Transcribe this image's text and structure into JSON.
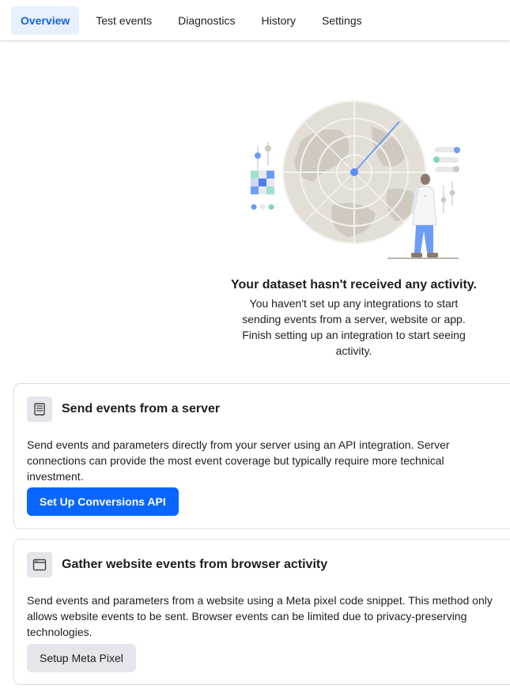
{
  "tabs": [
    {
      "label": "Overview",
      "active": true
    },
    {
      "label": "Test events",
      "active": false
    },
    {
      "label": "Diagnostics",
      "active": false
    },
    {
      "label": "History",
      "active": false
    },
    {
      "label": "Settings",
      "active": false
    }
  ],
  "empty_state": {
    "illustration_icon": "radar-scientist-illustration",
    "title": "Your dataset hasn't received any activity.",
    "description": "You haven't set up any integrations to start sending events from a server, website or app. Finish setting up an integration to start seeing activity."
  },
  "cards": [
    {
      "icon": "server-icon",
      "title": "Send events from a server",
      "body": "Send events and parameters directly from your server using an API integration. Server connections can provide the most event coverage but typically require more technical investment.",
      "button_label": "Set Up Conversions API"
    },
    {
      "icon": "browser-window-icon",
      "title": "Gather website events from browser activity",
      "body": "Send events and parameters from a website using a Meta pixel code snippet. This method only allows website events to be sent. Browser events can be limited due to privacy-preserving technologies.",
      "button_label": "Setup Meta Pixel"
    }
  ],
  "colors": {
    "accent": "#0866ff",
    "active_tab_bg": "#e7f0fd",
    "active_tab_text": "#1464d8"
  }
}
